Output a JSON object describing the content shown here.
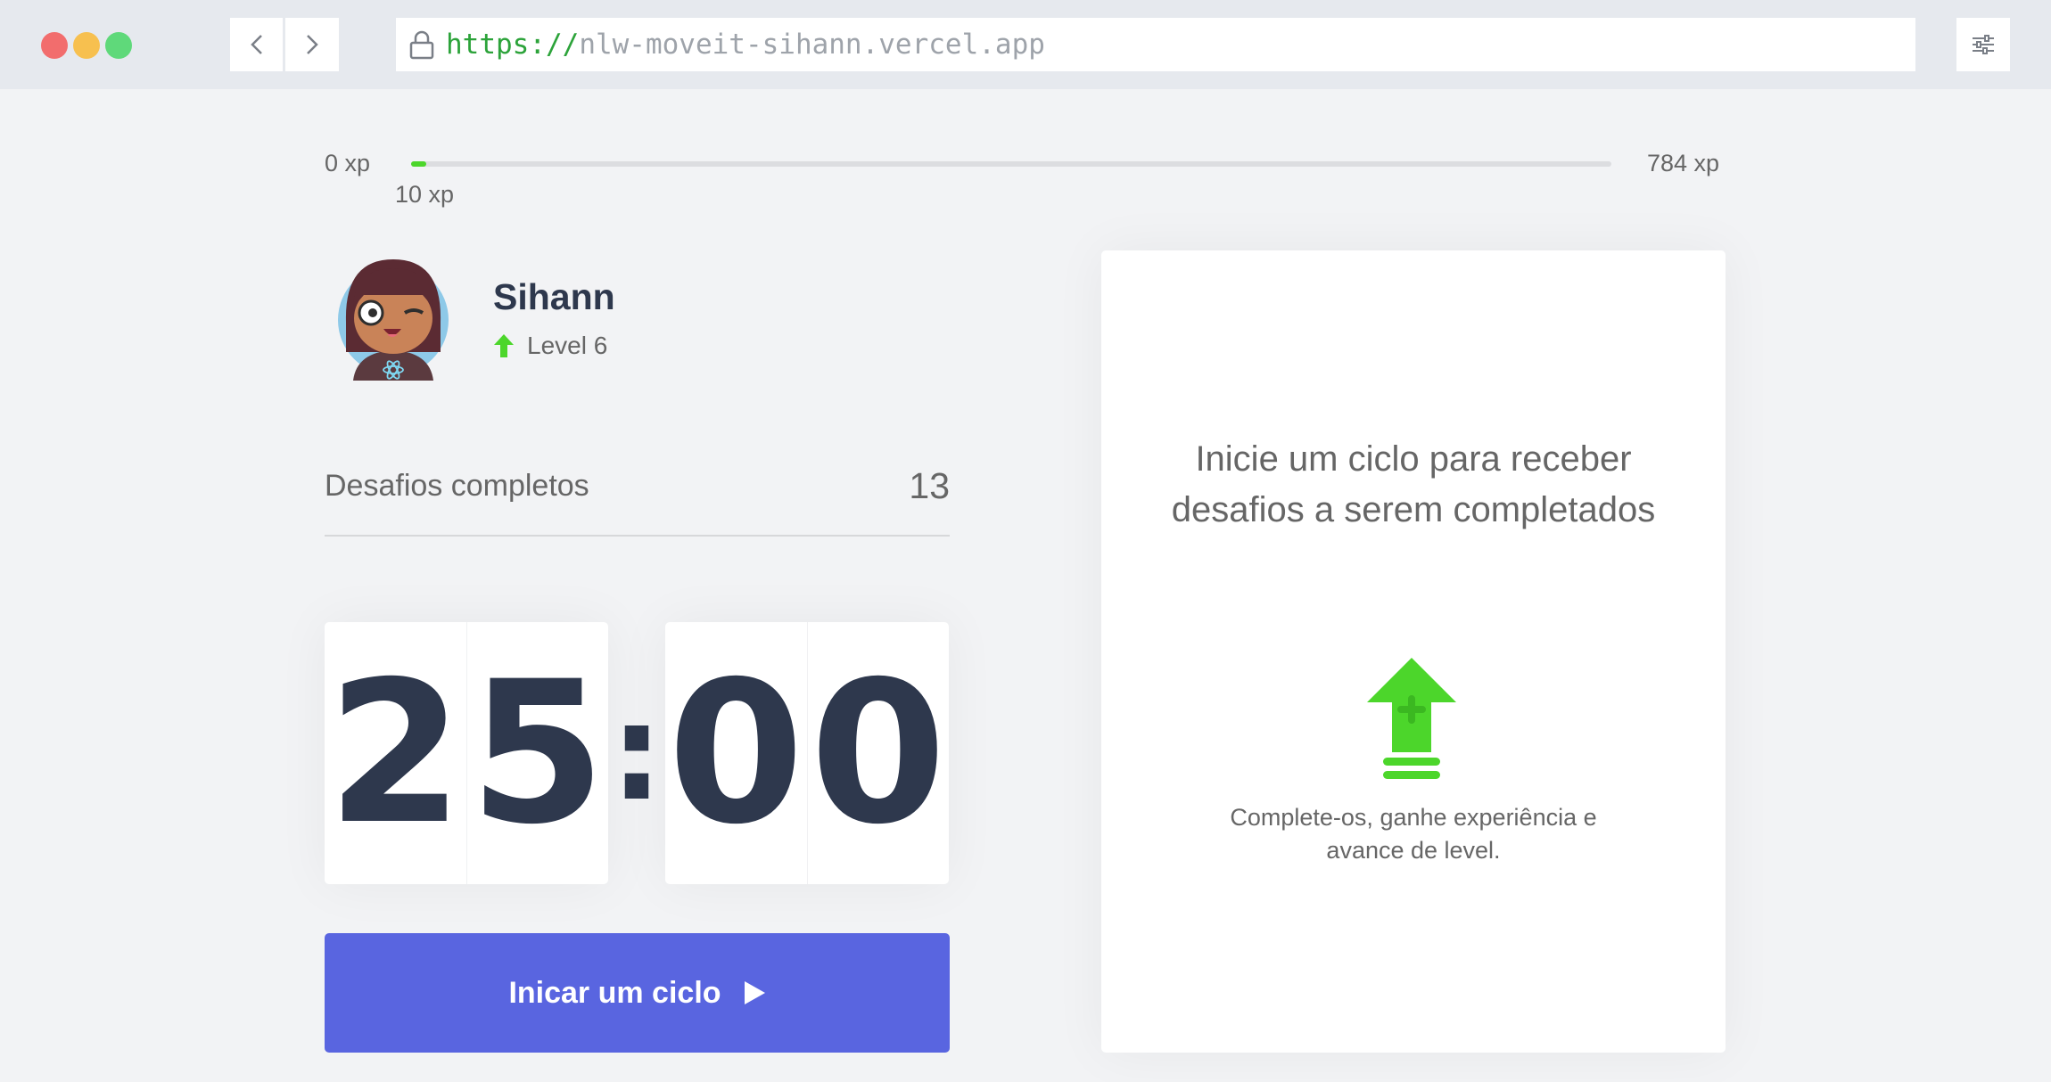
{
  "browser": {
    "url_scheme": "https://",
    "url_host": "nlw-moveit-sihann.vercel.app",
    "icons": [
      "back-icon",
      "forward-icon",
      "lock-icon",
      "settings-icon"
    ]
  },
  "xp": {
    "min_label": "0 xp",
    "current_label": "10 xp",
    "max_label": "784 xp",
    "current": 10,
    "max": 784,
    "progress_fraction": 0.0128
  },
  "profile": {
    "name": "Sihann",
    "level_label": "Level 6"
  },
  "completed_challenges": {
    "label": "Desafios completos",
    "value": "13"
  },
  "countdown": {
    "minute_left": "2",
    "minute_right": "5",
    "separator": ":",
    "second_left": "0",
    "second_right": "0"
  },
  "start_button": {
    "label": "Inicar um ciclo"
  },
  "challenge_box": {
    "title": "Inicie um ciclo para receber desafios a serem completados",
    "description": "Complete-os, ganhe experiência e avance de level."
  },
  "colors": {
    "accent_blue": "#5965e0",
    "accent_green": "#4cd62b",
    "title_dark": "#2e384d",
    "text": "#666666",
    "background": "#f2f3f5"
  }
}
